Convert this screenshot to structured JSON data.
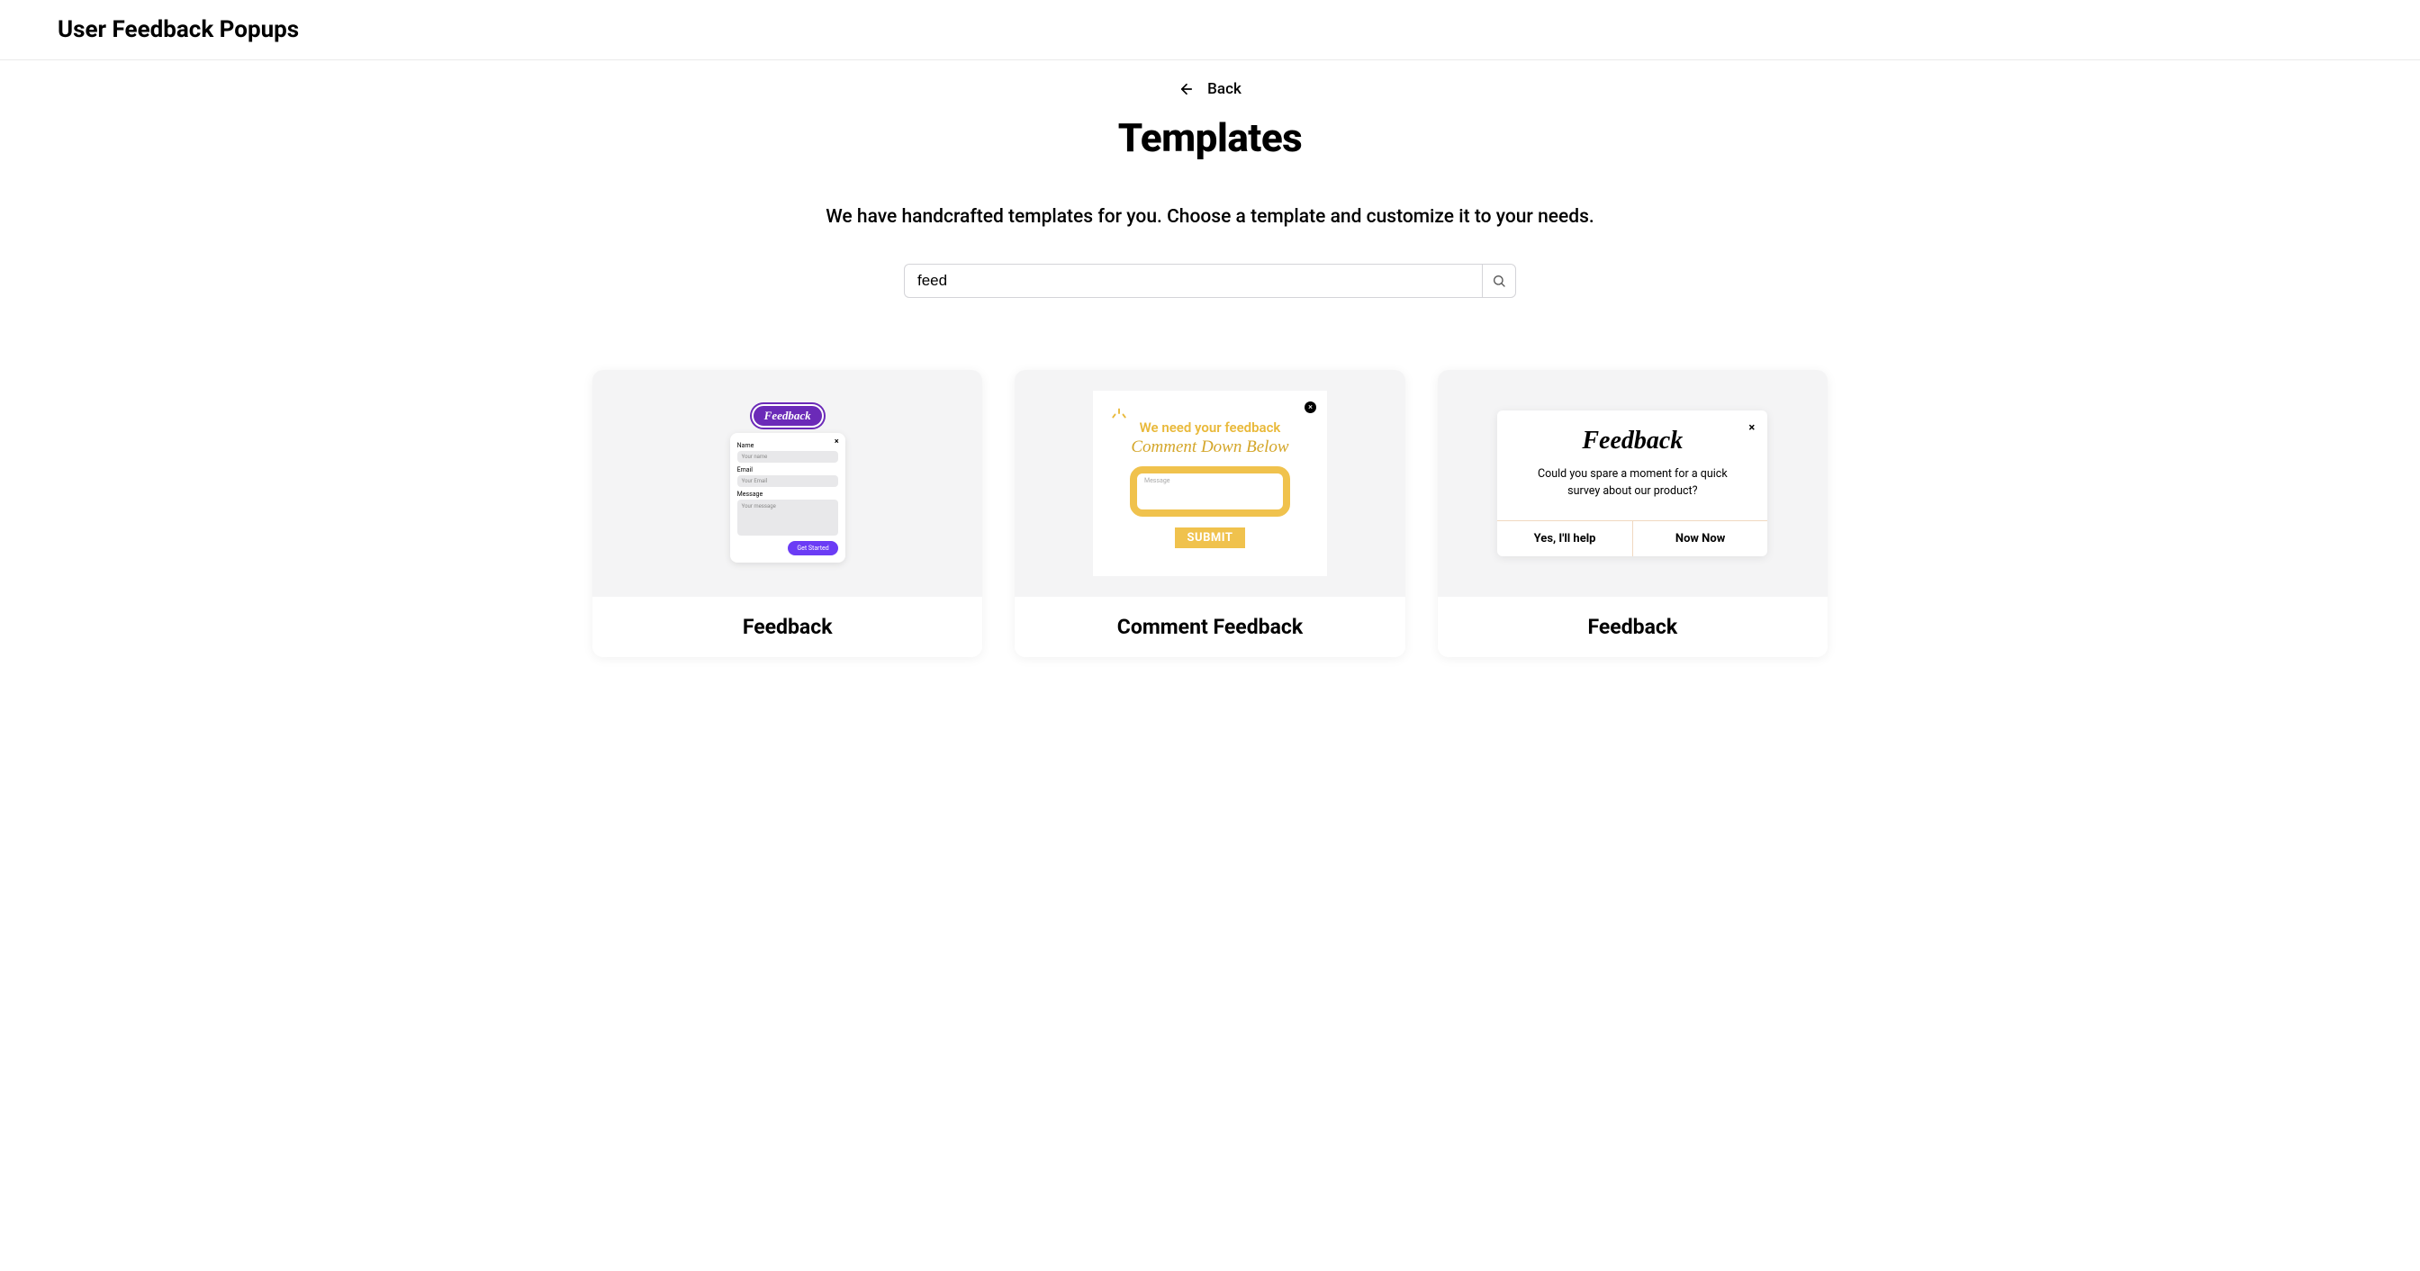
{
  "header": {
    "title": "User Feedback Popups"
  },
  "back": {
    "label": "Back"
  },
  "page": {
    "heading": "Templates",
    "subheading": "We have handcrafted templates for you. Choose a template and customize it to your needs."
  },
  "search": {
    "value": "feed",
    "placeholder": ""
  },
  "cards": [
    {
      "label": "Feedback"
    },
    {
      "label": "Comment Feedback"
    },
    {
      "label": "Feedback"
    }
  ],
  "preview1": {
    "badge": "Feedback",
    "close": "×",
    "name_label": "Name",
    "name_ph": "Your name",
    "email_label": "Email",
    "email_ph": "Your Email",
    "message_label": "Message",
    "message_ph": "Your message",
    "button": "Get Started"
  },
  "preview2": {
    "close": "×",
    "title1": "We need your feedback",
    "title2": "Comment Down Below",
    "msg_ph": "Message",
    "submit": "SUBMIT"
  },
  "preview3": {
    "close": "×",
    "heading": "Feedback",
    "body": "Could you spare a moment for a quick survey about our product?",
    "btn1": "Yes, I'll help",
    "btn2": "Now Now"
  }
}
